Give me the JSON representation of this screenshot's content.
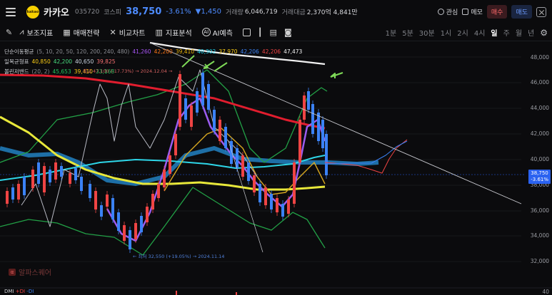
{
  "header": {
    "logo_text": "kakao",
    "stock_name": "카카오",
    "stock_code": "035720",
    "market": "코스피",
    "price": "38,750",
    "change_pct": "-3.61%",
    "change": "▼1,450",
    "volume_label": "거래량",
    "volume": "6,046,719",
    "amount_label": "거래대금",
    "amount": "2,370억 4,841만",
    "interest_label": "관심",
    "memo_label": "메모",
    "buy_label": "매수",
    "sell_label": "매도"
  },
  "toolbar": {
    "indicators_label": "보조지표",
    "strategy_label": "매매전략",
    "compare_label": "비교차트",
    "analysis_label": "지표분석",
    "ai_label": "AI예측",
    "periods": [
      "1분",
      "5분",
      "30분",
      "1시",
      "2시",
      "4시",
      "일",
      "주",
      "월",
      "년"
    ],
    "active_period": "일"
  },
  "legend": {
    "ma_title": "단순이동평균",
    "ma_params": "(5, 10, 20, 50, 120, 200, 240, 480)",
    "ma_values": [
      {
        "v": "41,260",
        "color": "#a855f7"
      },
      {
        "v": "42,200",
        "color": "#f97316"
      },
      {
        "v": "39,410",
        "color": "#eab308"
      },
      {
        "v": "40,302",
        "color": "#22d3ee"
      },
      {
        "v": "37,970",
        "color": "#facc15"
      },
      {
        "v": "42,206",
        "color": "#3b82f6"
      },
      {
        "v": "42,206",
        "color": "#ef4444"
      },
      {
        "v": "47,473",
        "color": "#f5f5f5"
      }
    ],
    "ichimoku_title": "일목균형표",
    "ichimoku_values": [
      {
        "v": "40,850",
        "color": "#facc15"
      },
      {
        "v": "42,200",
        "color": "#4ade80"
      },
      {
        "v": "40,650",
        "color": "#cbd5e1"
      },
      {
        "v": "39,825",
        "color": "#f87171"
      }
    ],
    "bb_title": "볼린저밴드",
    "bb_params": "(20, 2)",
    "bb_values": [
      {
        "v": "45,653",
        "color": "#22c55e"
      },
      {
        "v": "39,410",
        "color": "#facc15"
      },
      {
        "v": "33,168",
        "color": "#22c55e"
      }
    ]
  },
  "annotations": {
    "high": "최고 47,100 (-17.73%) → 2024.12.04 →",
    "low": "← 최저 32,550 (+19.05%) → 2024.11.14"
  },
  "y_axis": [
    "48,000",
    "46,000",
    "44,000",
    "42,000",
    "40,000",
    "38,000",
    "36,000",
    "34,000",
    "32,000"
  ],
  "price_tag": {
    "price": "38,750",
    "pct": "-3.61%"
  },
  "watermark": "알파스퀘어",
  "dmi": {
    "title": "DMI",
    "plus": "+DI",
    "minus": "-DI"
  },
  "dmi_axis": "40",
  "colors": {
    "up": "#ef4444",
    "down": "#3b82f6",
    "bg": "#0b0b0d"
  }
}
